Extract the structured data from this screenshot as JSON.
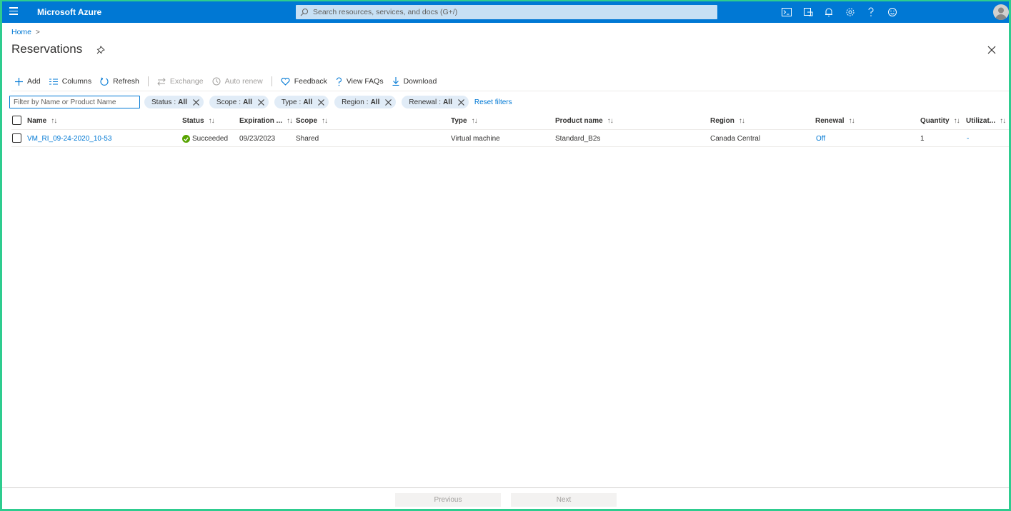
{
  "app": {
    "brand": "Microsoft Azure"
  },
  "search": {
    "placeholder": "Search resources, services, and docs (G+/)"
  },
  "breadcrumb": {
    "home": "Home",
    "separator": ">"
  },
  "page": {
    "title": "Reservations"
  },
  "toolbar": {
    "add": "Add",
    "columns": "Columns",
    "refresh": "Refresh",
    "exchange": "Exchange",
    "auto_renew": "Auto renew",
    "feedback": "Feedback",
    "view_faqs": "View FAQs",
    "download": "Download"
  },
  "filters": {
    "placeholder": "Filter by Name or Product Name",
    "pills": [
      {
        "label": "Status",
        "value": "All"
      },
      {
        "label": "Scope",
        "value": "All"
      },
      {
        "label": "Type",
        "value": "All"
      },
      {
        "label": "Region",
        "value": "All"
      },
      {
        "label": "Renewal",
        "value": "All"
      }
    ],
    "reset": "Reset filters",
    "separator": ":"
  },
  "table": {
    "sort_glyph": "↑↓",
    "columns": {
      "name": "Name",
      "status": "Status",
      "expiration": "Expiration ...",
      "scope": "Scope",
      "type": "Type",
      "product": "Product name",
      "region": "Region",
      "renewal": "Renewal",
      "quantity": "Quantity",
      "utilization": "Utilizat..."
    },
    "rows": [
      {
        "name": "VM_RI_09-24-2020_10-53",
        "status": "Succeeded",
        "expiration": "09/23/2023",
        "scope": "Shared",
        "type": "Virtual machine",
        "product": "Standard_B2s",
        "region": "Canada Central",
        "renewal": "Off",
        "quantity": "1",
        "utilization": "-"
      }
    ]
  },
  "pager": {
    "previous": "Previous",
    "next": "Next"
  },
  "colors": {
    "accent": "#0078d4",
    "success": "#57a300",
    "frame": "#2ecc8f"
  }
}
